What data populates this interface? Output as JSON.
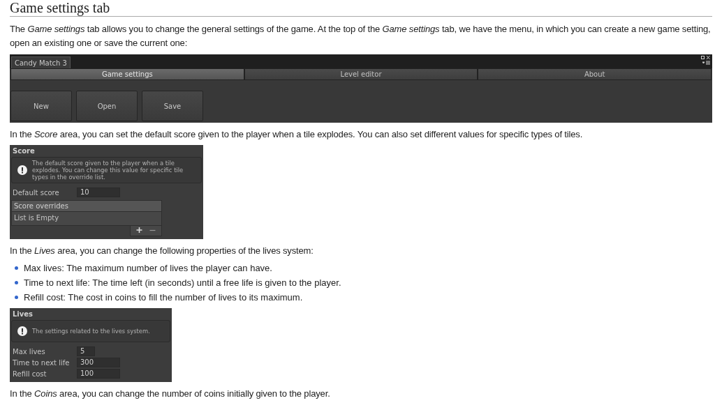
{
  "heading": "Game settings tab",
  "intro": "The *Game settings* tab allows you to change the general settings of the game. At the top of the *Game settings* tab, we have the menu, in which you can create a new game setting, open an existing one or save the current one:",
  "game_window": {
    "title": "Candy Match 3",
    "tabs": [
      {
        "label": "Game settings",
        "selected": true
      },
      {
        "label": "Level editor",
        "selected": false
      },
      {
        "label": "About",
        "selected": false
      }
    ],
    "buttons": [
      "New",
      "Open",
      "Save"
    ]
  },
  "score_text": "In the *Score* area, you can set the default score given to the player when a tile explodes. You can also set different values for specific types of tiles.",
  "score_panel": {
    "title": "Score",
    "info": "The default score given to the player when a tile explodes. You can change this value for specific tile types in the override list.",
    "fields": [
      {
        "label": "Default score",
        "value": "10"
      }
    ],
    "list": {
      "header": "Score overrides",
      "empty_text": "List is Empty"
    }
  },
  "lives_text": "In the *Lives* area, you can change the following properties of the lives system:",
  "lives_properties": [
    "Max lives: The maximum number of lives the player can have.",
    "Time to next life: The time left (in seconds) until a free life is given to the player.",
    "Refill cost: The cost in coins to fill the number of lives to its maximum."
  ],
  "lives_panel": {
    "title": "Lives",
    "info": "The settings related to the lives system.",
    "fields": [
      {
        "label": "Max lives",
        "value": "5"
      },
      {
        "label": "Time to next life",
        "value": "300"
      },
      {
        "label": "Refill cost",
        "value": "100"
      }
    ]
  },
  "coins_text": "In the *Coins* area, you can change the number of coins initially given to the player."
}
